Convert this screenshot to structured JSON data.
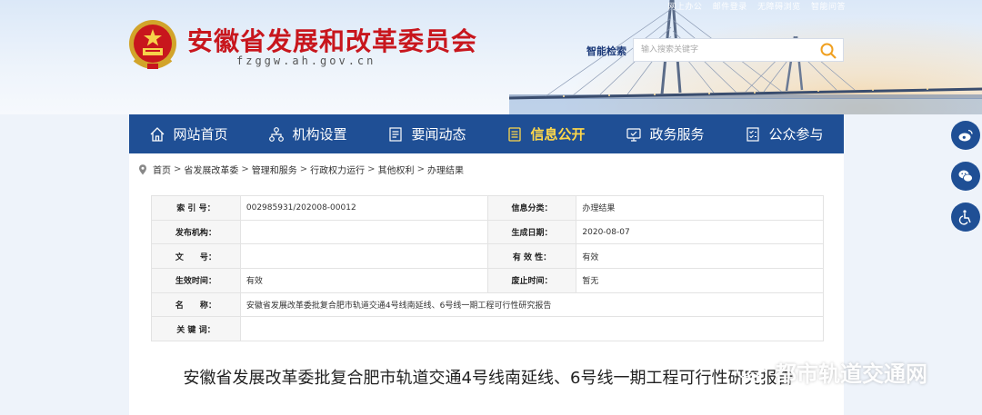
{
  "header": {
    "top_links": [
      "网上办公",
      "邮件登录",
      "无障碍浏览",
      "智能问答"
    ],
    "site_title": "安徽省发展和改革委员会",
    "site_domain": "fzggw.ah.gov.cn",
    "search_label": "智能检索",
    "search_placeholder": "输入搜索关键字"
  },
  "nav": {
    "items": [
      {
        "label": "网站首页",
        "icon": "home-icon"
      },
      {
        "label": "机构设置",
        "icon": "org-chart-icon"
      },
      {
        "label": "要闻动态",
        "icon": "news-icon"
      },
      {
        "label": "信息公开",
        "icon": "info-public-icon",
        "active": true
      },
      {
        "label": "政务服务",
        "icon": "service-icon"
      },
      {
        "label": "公众参与",
        "icon": "participation-icon"
      }
    ]
  },
  "breadcrumb": [
    "首页",
    "省发展改革委",
    "管理和服务",
    "行政权力运行",
    "其他权利",
    "办理结果"
  ],
  "info": {
    "index_no_label": "索 引 号：",
    "index_no": "002985931/202008-00012",
    "category_label": "信息分类：",
    "category": "办理结果",
    "publisher_label": "发布机构：",
    "publisher": "",
    "created_label": "生成日期：",
    "created": "2020-08-07",
    "doc_no_label": "文　　号：",
    "doc_no": "",
    "validity_label": "有 效 性：",
    "validity": "有效",
    "effective_label": "生效时间：",
    "effective": "有效",
    "abolish_label": "废止时间：",
    "abolish": "暂无",
    "name_label": "名　　称：",
    "name": "安徽省发展改革委批复合肥市轨道交通4号线南延线、6号线一期工程可行性研究报告",
    "keywords_label": "关 键 词：",
    "keywords": ""
  },
  "doc_title": "安徽省发展改革委批复合肥市轨道交通4号线南延线、6号线一期工程可行性研究报告",
  "side_buttons": [
    "weibo-icon",
    "wechat-icon",
    "accessibility-icon"
  ],
  "watermark": "都市轨道交通网",
  "colors": {
    "brand_red": "#c8161d",
    "nav_blue": "#1f4f95",
    "nav_active": "#ffd84a"
  }
}
